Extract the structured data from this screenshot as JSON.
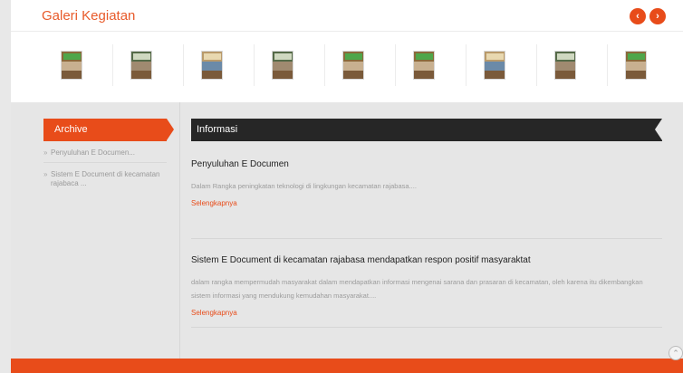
{
  "gallery": {
    "title": "Galeri Kegiatan",
    "prev_icon": "‹",
    "next_icon": "›",
    "thumbnail_count": 9
  },
  "sidebar": {
    "header": "Archive",
    "items": [
      {
        "bullet": "»",
        "label": "Penyuluhan E Documen..."
      },
      {
        "bullet": "»",
        "label": "Sistem E Document di kecamatan rajabaca ..."
      }
    ]
  },
  "main": {
    "header": "Informasi",
    "posts": [
      {
        "title": "Penyuluhan E Documen",
        "excerpt": "Dalam Rangka peningkatan teknologi di lingkungan kecamatan rajabasa....",
        "more": "Selengkapnya"
      },
      {
        "title": "Sistem E Document di kecamatan rajabasa mendapatkan respon positif masyaraktat",
        "excerpt": "dalam rangka mempermudah masyarakat dalam mendapatkan informasi mengenai sarana dan prasaran di kecamatan, oleh karena itu dikembangkan sistem informasi yang mendukung kemudahan masyarakat....",
        "more": "Selengkapnya"
      }
    ]
  },
  "colors": {
    "accent": "#e84c1a",
    "dark_header": "#262626",
    "background": "#e6e6e6"
  },
  "icons": {
    "prev": "chevron-left-icon",
    "next": "chevron-right-icon",
    "scroll_top": "chevron-up-icon"
  }
}
